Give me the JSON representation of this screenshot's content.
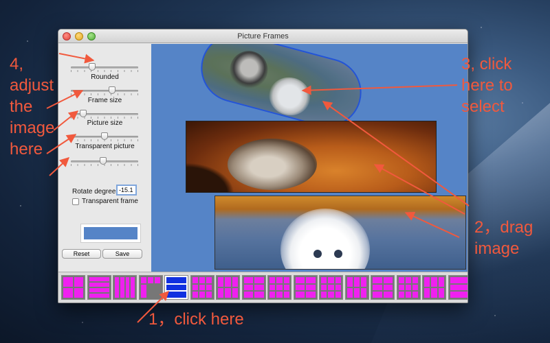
{
  "window": {
    "title": "Picture Frames"
  },
  "sidebar": {
    "sliders": [
      {
        "label": "Rounded",
        "value_fraction": 0.3
      },
      {
        "label": "Frame size",
        "value_fraction": 0.62
      },
      {
        "label": "Picture size",
        "value_fraction": 0.15
      },
      {
        "label": "Transparent picture",
        "value_fraction": 0.5
      },
      {
        "label": "",
        "value_fraction": 0.48
      }
    ],
    "rotate_label": "Rotate degree",
    "rotate_value": "-15.1",
    "transparent_frame_label": "Transparent frame",
    "transparent_frame_checked": false,
    "frame_color": "#5584c7",
    "reset_label": "Reset",
    "save_label": "Save"
  },
  "canvas": {
    "background": "#5584c7"
  },
  "frame_strip": {
    "count": 17,
    "selected_index": 4
  },
  "annotations": {
    "a1": "1，click here",
    "a2_line1": "2，drag",
    "a2_line2": "image",
    "a3_line1": "3, click",
    "a3_line2": "here to",
    "a3_line3": "select",
    "a4_line1": "4,",
    "a4_line2": "adjust",
    "a4_line3": "the",
    "a4_line4": "image",
    "a4_line5": "here"
  },
  "colors": {
    "annotation": "#f1593d",
    "frame_magenta": "#f020f0",
    "frame_selected": "#1030e0"
  }
}
